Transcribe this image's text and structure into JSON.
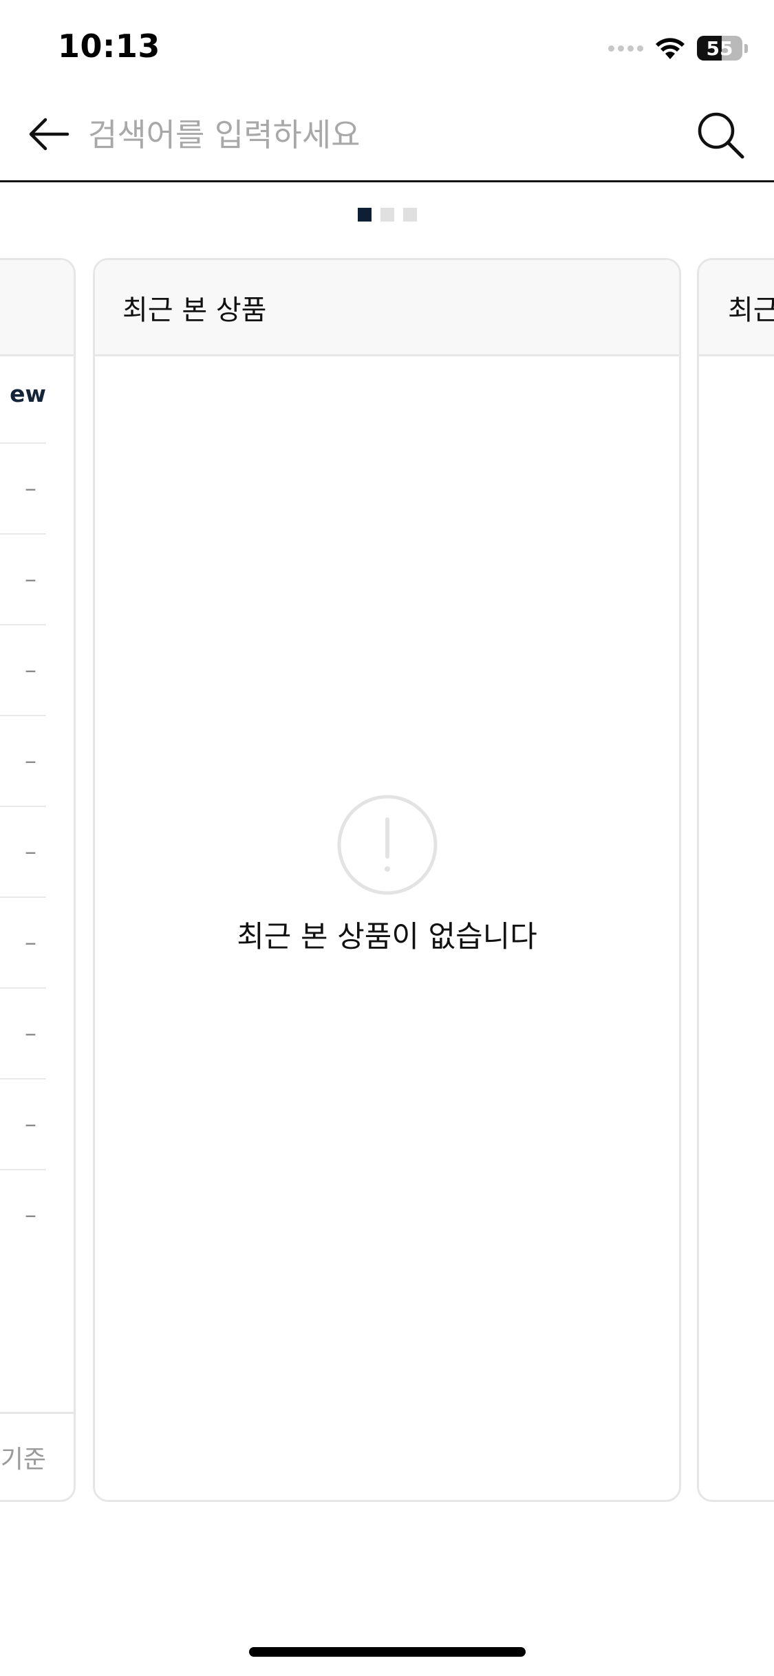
{
  "status_bar": {
    "time": "10:13",
    "battery_level": "55",
    "battery_fraction": 0.55
  },
  "search": {
    "placeholder": "검색어를 입력하세요",
    "back_icon": "arrow-left-icon",
    "search_icon": "search-icon"
  },
  "pager": {
    "pages": 3,
    "active_index": 0,
    "active_color": "#0d2033",
    "inactive_color": "#e0e0e0"
  },
  "cards": {
    "left": {
      "column_header": "ew",
      "rows": [
        "–",
        "–",
        "–",
        "–",
        "–",
        "–",
        "–",
        "–",
        "–"
      ],
      "footer": "기준"
    },
    "center": {
      "title": "최근 본 상품",
      "empty_message": "최근 본 상품이 없습니다",
      "empty_icon": "exclamation-circle-icon"
    },
    "right": {
      "title": "최근"
    }
  }
}
